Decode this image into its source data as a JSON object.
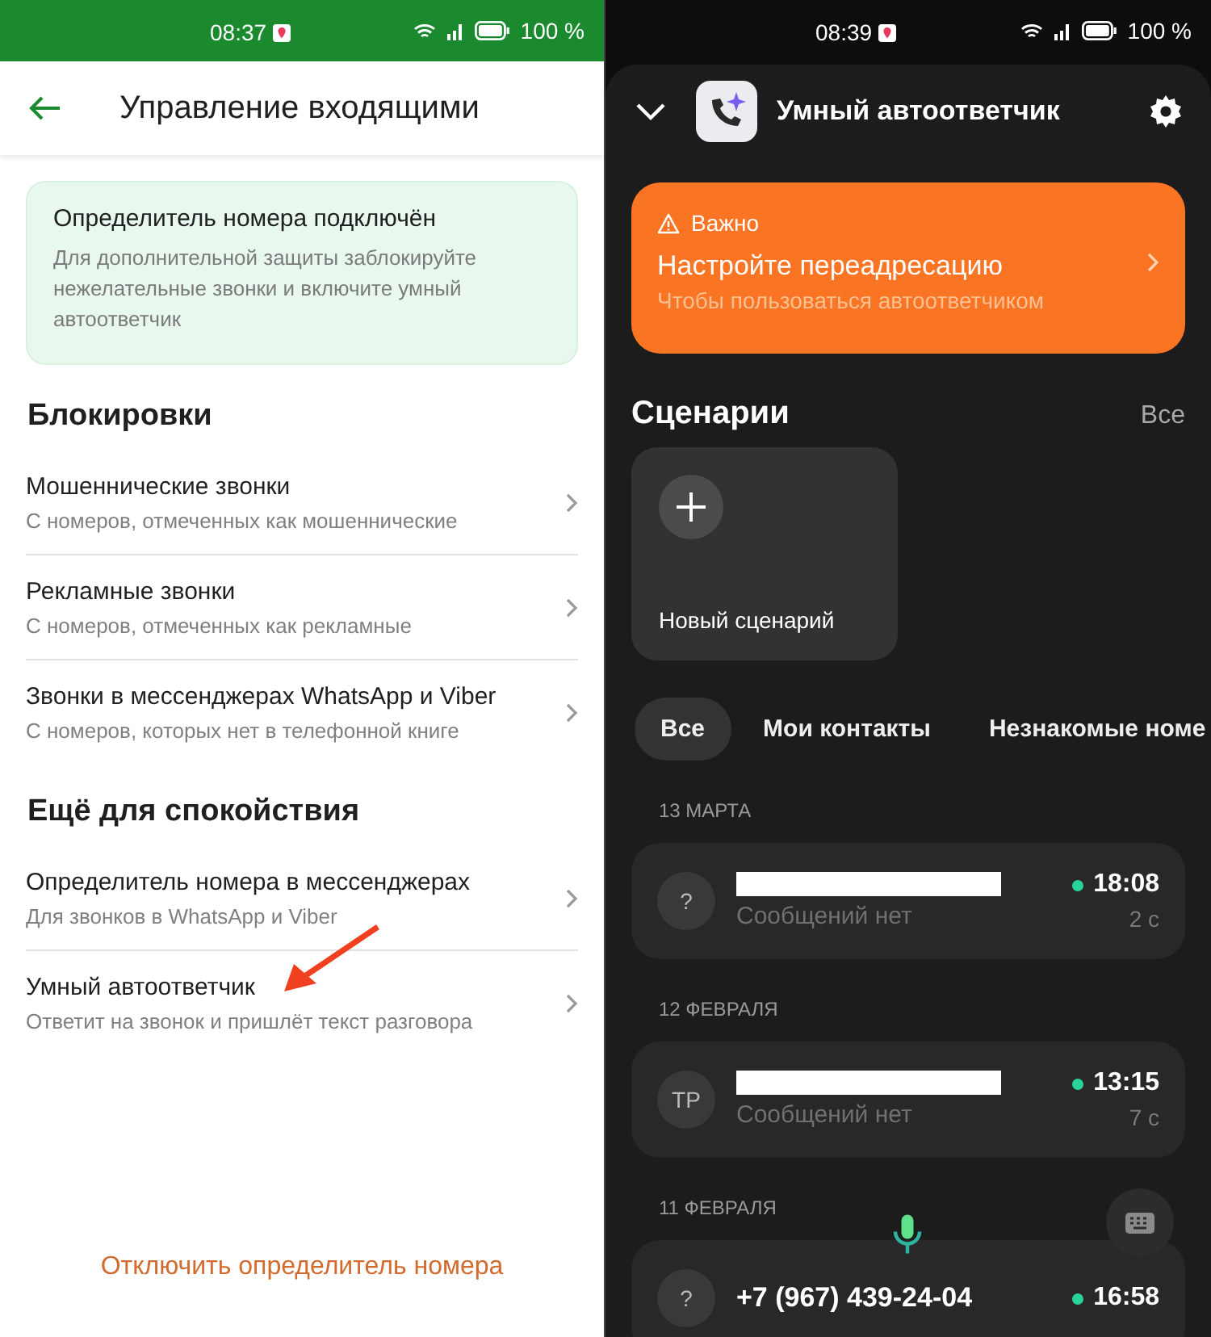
{
  "left_screen": {
    "status_bar": {
      "time": "08:37",
      "battery": "100 %"
    },
    "header": {
      "title": "Управление входящими"
    },
    "banner": {
      "title": "Определитель номера подключён",
      "text": "Для дополнительной защиты заблокируйте нежелательные звонки и включите умный автоответчик"
    },
    "sections": [
      {
        "heading": "Блокировки",
        "items": [
          {
            "title": "Мошеннические звонки",
            "subtitle": "С номеров, отмеченных как мошеннические"
          },
          {
            "title": "Рекламные звонки",
            "subtitle": "С номеров, отмеченных как рекламные"
          },
          {
            "title": "Звонки в мессенджерах WhatsApp и Viber",
            "subtitle": "С номеров, которых нет в телефонной книге"
          }
        ]
      },
      {
        "heading": "Ещё для спокойствия",
        "items": [
          {
            "title": "Определитель номера в мессенджерах",
            "subtitle": "Для звонков в WhatsApp и Viber"
          },
          {
            "title": "Умный автоответчик",
            "subtitle": "Ответит на звонок и пришлёт текст разговора"
          }
        ]
      }
    ],
    "footer_link": "Отключить определитель номера"
  },
  "right_screen": {
    "status_bar": {
      "time": "08:39",
      "battery": "100 %"
    },
    "header": {
      "title": "Умный автоответчик"
    },
    "alert": {
      "label": "Важно",
      "title": "Настройте переадресацию",
      "subtitle": "Чтобы пользоваться автоответчиком"
    },
    "scenarios": {
      "heading": "Сценарии",
      "all_link": "Все",
      "new_card": "Новый сценарий"
    },
    "filters": [
      {
        "label": "Все",
        "selected": true
      },
      {
        "label": "Мои контакты",
        "selected": false
      },
      {
        "label": "Незнакомые номе",
        "selected": false
      }
    ],
    "calls": [
      {
        "date": "13 МАРТА",
        "avatar": "?",
        "redacted": true,
        "subtitle": "Сообщений нет",
        "time": "18:08",
        "duration": "2 с",
        "color": "#2bd39c"
      },
      {
        "date": "12 ФЕВРАЛЯ",
        "avatar": "ТР",
        "redacted": true,
        "subtitle": "Сообщений нет",
        "time": "13:15",
        "duration": "7 с",
        "color": "#2bd39c"
      },
      {
        "date": "11 ФЕВРАЛЯ",
        "avatar": "?",
        "redacted": false,
        "name": "+7 (967) 439-24-04",
        "time": "16:58",
        "color": "#2bd39c"
      }
    ]
  }
}
